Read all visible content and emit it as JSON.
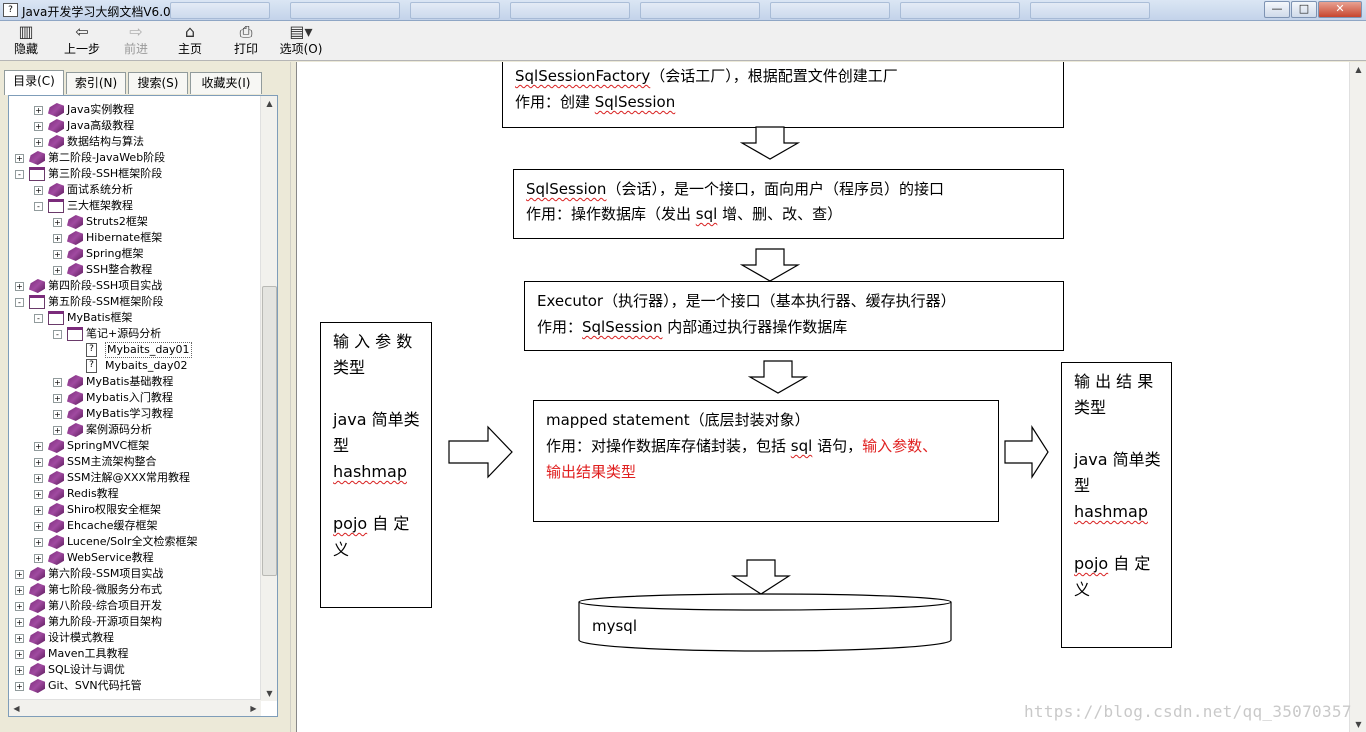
{
  "window": {
    "title": "Java开发学习大纲文档V6.0",
    "app_icon_glyph": "?",
    "minimize": "—",
    "maximize": "□",
    "close": "✕"
  },
  "toolbar": {
    "hide": "隐藏",
    "back": "上一步",
    "forward": "前进",
    "home": "主页",
    "print": "打印",
    "options": "选项(O)"
  },
  "tabs": {
    "contents": "目录(C)",
    "index": "索引(N)",
    "search": "搜索(S)",
    "favorites": "收藏夹(I)"
  },
  "tree": [
    {
      "label": "Java实例教程",
      "level": 1,
      "toggle": "+",
      "icon": "closed"
    },
    {
      "label": "Java高级教程",
      "level": 1,
      "toggle": "+",
      "icon": "closed"
    },
    {
      "label": "数据结构与算法",
      "level": 1,
      "toggle": "+",
      "icon": "closed"
    },
    {
      "label": "第二阶段-JavaWeb阶段",
      "level": 0,
      "toggle": "+",
      "icon": "closed"
    },
    {
      "label": "第三阶段-SSH框架阶段",
      "level": 0,
      "toggle": "-",
      "icon": "open"
    },
    {
      "label": "面试系统分析",
      "level": 1,
      "toggle": "+",
      "icon": "closed"
    },
    {
      "label": "三大框架教程",
      "level": 1,
      "toggle": "-",
      "icon": "open"
    },
    {
      "label": "Struts2框架",
      "level": 2,
      "toggle": "+",
      "icon": "closed"
    },
    {
      "label": "Hibernate框架",
      "level": 2,
      "toggle": "+",
      "icon": "closed"
    },
    {
      "label": "Spring框架",
      "level": 2,
      "toggle": "+",
      "icon": "closed"
    },
    {
      "label": "SSH整合教程",
      "level": 2,
      "toggle": "+",
      "icon": "closed"
    },
    {
      "label": "第四阶段-SSH项目实战",
      "level": 0,
      "toggle": "+",
      "icon": "closed"
    },
    {
      "label": "第五阶段-SSM框架阶段",
      "level": 0,
      "toggle": "-",
      "icon": "open"
    },
    {
      "label": "MyBatis框架",
      "level": 1,
      "toggle": "-",
      "icon": "open"
    },
    {
      "label": "笔记+源码分析",
      "level": 2,
      "toggle": "-",
      "icon": "open"
    },
    {
      "label": "Mybaits_day01",
      "level": 3,
      "toggle": "",
      "icon": "page",
      "selected": true
    },
    {
      "label": "Mybaits_day02",
      "level": 3,
      "toggle": "",
      "icon": "page"
    },
    {
      "label": "MyBatis基础教程",
      "level": 2,
      "toggle": "+",
      "icon": "closed"
    },
    {
      "label": "Mybatis入门教程",
      "level": 2,
      "toggle": "+",
      "icon": "closed"
    },
    {
      "label": "MyBatis学习教程",
      "level": 2,
      "toggle": "+",
      "icon": "closed"
    },
    {
      "label": "案例源码分析",
      "level": 2,
      "toggle": "+",
      "icon": "closed"
    },
    {
      "label": "SpringMVC框架",
      "level": 1,
      "toggle": "+",
      "icon": "closed"
    },
    {
      "label": "SSM主流架构整合",
      "level": 1,
      "toggle": "+",
      "icon": "closed"
    },
    {
      "label": "SSM注解@XXX常用教程",
      "level": 1,
      "toggle": "+",
      "icon": "closed"
    },
    {
      "label": "Redis教程",
      "level": 1,
      "toggle": "+",
      "icon": "closed"
    },
    {
      "label": "Shiro权限安全框架",
      "level": 1,
      "toggle": "+",
      "icon": "closed"
    },
    {
      "label": "Ehcache缓存框架",
      "level": 1,
      "toggle": "+",
      "icon": "closed"
    },
    {
      "label": "Lucene/Solr全文检索框架",
      "level": 1,
      "toggle": "+",
      "icon": "closed"
    },
    {
      "label": "WebService教程",
      "level": 1,
      "toggle": "+",
      "icon": "closed"
    },
    {
      "label": "第六阶段-SSM项目实战",
      "level": 0,
      "toggle": "+",
      "icon": "closed"
    },
    {
      "label": "第七阶段-微服务分布式",
      "level": 0,
      "toggle": "+",
      "icon": "closed"
    },
    {
      "label": "第八阶段-综合项目开发",
      "level": 0,
      "toggle": "+",
      "icon": "closed"
    },
    {
      "label": "第九阶段-开源项目架构",
      "level": 0,
      "toggle": "+",
      "icon": "closed"
    },
    {
      "label": "设计模式教程",
      "level": 0,
      "toggle": "+",
      "icon": "closed"
    },
    {
      "label": "Maven工具教程",
      "level": 0,
      "toggle": "+",
      "icon": "closed"
    },
    {
      "label": "SQL设计与调优",
      "level": 0,
      "toggle": "+",
      "icon": "closed"
    },
    {
      "label": "Git、SVN代码托管",
      "level": 0,
      "toggle": "+",
      "icon": "closed"
    }
  ],
  "diagram": {
    "factory": {
      "line1_term": "SqlSessionFactory",
      "line1_rest": "（会话工厂），根据配置文件创建工厂",
      "line2_pre": "作用：创建 ",
      "line2_term": "SqlSession"
    },
    "session": {
      "line1_term": "SqlSession",
      "line1_rest": "（会话），是一个接口，面向用户（程序员）的接口",
      "line2_pre": "作用：操作数据库（发出 ",
      "line2_term": "sql",
      "line2_post": " 增、删、改、查）"
    },
    "executor": {
      "line1": "Executor（执行器），是一个接口（基本执行器、缓存执行器）",
      "line2_pre": "作用：",
      "line2_term": "SqlSession",
      "line2_post": " 内部通过执行器操作数据库"
    },
    "mapped": {
      "line1": "mapped statement（底层封装对象）",
      "line2_pre": "作用：对操作数据库存储封装，包括 ",
      "line2_term": "sql",
      "line2_post": " 语句，",
      "line2_red": "输入参数、",
      "line3_red": "输出结果类型"
    },
    "input": {
      "title_a": "输 入 参 数",
      "title_b": "类型",
      "java_a": "java 简单类",
      "java_b": "型",
      "hashmap": "hashmap",
      "pojo_term": "pojo",
      "pojo_rest": " 自 定",
      "pojo_b": "义"
    },
    "output": {
      "title_a": "输 出 结 果",
      "title_b": "类型",
      "java_a": "java 简单类",
      "java_b": "型",
      "hashmap": "hashmap",
      "pojo_term": "pojo",
      "pojo_rest": " 自 定",
      "pojo_b": "义"
    },
    "db": "mysql"
  },
  "watermark": "https://blog.csdn.net/qq_35070357",
  "colors": {
    "highlight_red": "#e02020",
    "book_purple": "#7b2b7b"
  }
}
